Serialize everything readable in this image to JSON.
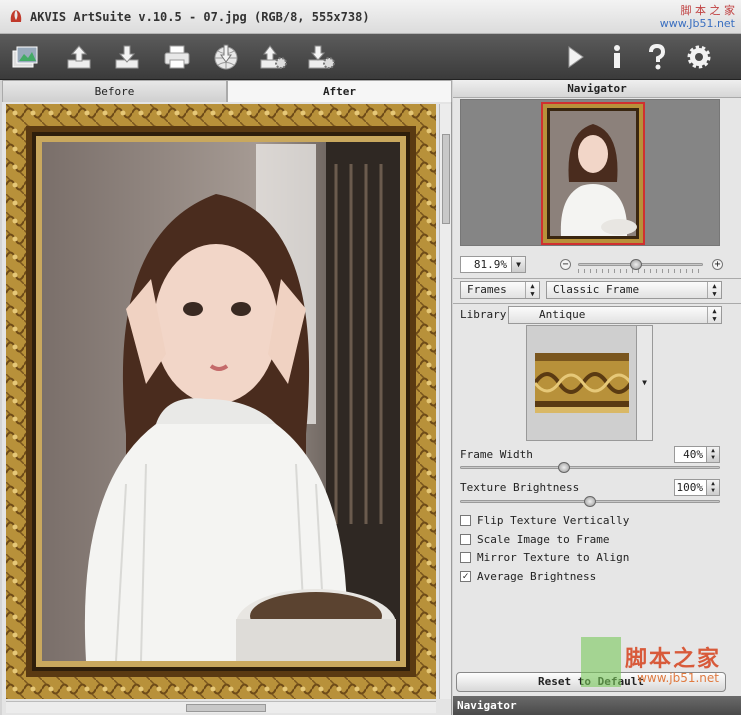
{
  "window": {
    "title": "AKVIS ArtSuite v.10.5 - 07.jpg (RGB/8, 555x738)",
    "watermark_top_cn": "脚 本 之 家",
    "watermark_top_url": "www.Jb51.net"
  },
  "toolbar": {
    "left_icons": [
      "open-image-icon",
      "save-image-icon",
      "print-icon",
      "share-icon",
      "load-preset-icon",
      "save-preset-icon"
    ],
    "right_icons": [
      "run-icon",
      "info-icon",
      "help-icon",
      "settings-icon"
    ]
  },
  "tabs": {
    "before": "Before",
    "after": "After"
  },
  "navigator": {
    "header": "Navigator",
    "zoom": "81.9%",
    "footer": "Navigator"
  },
  "settings": {
    "effect_type": "Frames",
    "frame_style": "Classic Frame",
    "library_label": "Library",
    "library_value": "Antique",
    "frame_width_label": "Frame Width",
    "frame_width_value": "40%",
    "frame_width_fraction": 0.4,
    "texture_brightness_label": "Texture Brightness",
    "texture_brightness_value": "100%",
    "texture_brightness_fraction": 0.5,
    "checkboxes": [
      {
        "label": "Flip Texture Vertically",
        "checked": false
      },
      {
        "label": "Scale Image to Frame",
        "checked": false
      },
      {
        "label": "Mirror Texture to Align",
        "checked": false
      },
      {
        "label": "Average Brightness",
        "checked": true
      }
    ],
    "reset_button": "Reset to Default"
  },
  "watermark_bottom": {
    "cn": "脚本之家",
    "url": "www.jb51.net"
  },
  "colors": {
    "frame_gold": "#b8913a",
    "frame_dark": "#5a3a12",
    "toolbar": "#4a4a4a",
    "accent_red": "#c04040"
  }
}
